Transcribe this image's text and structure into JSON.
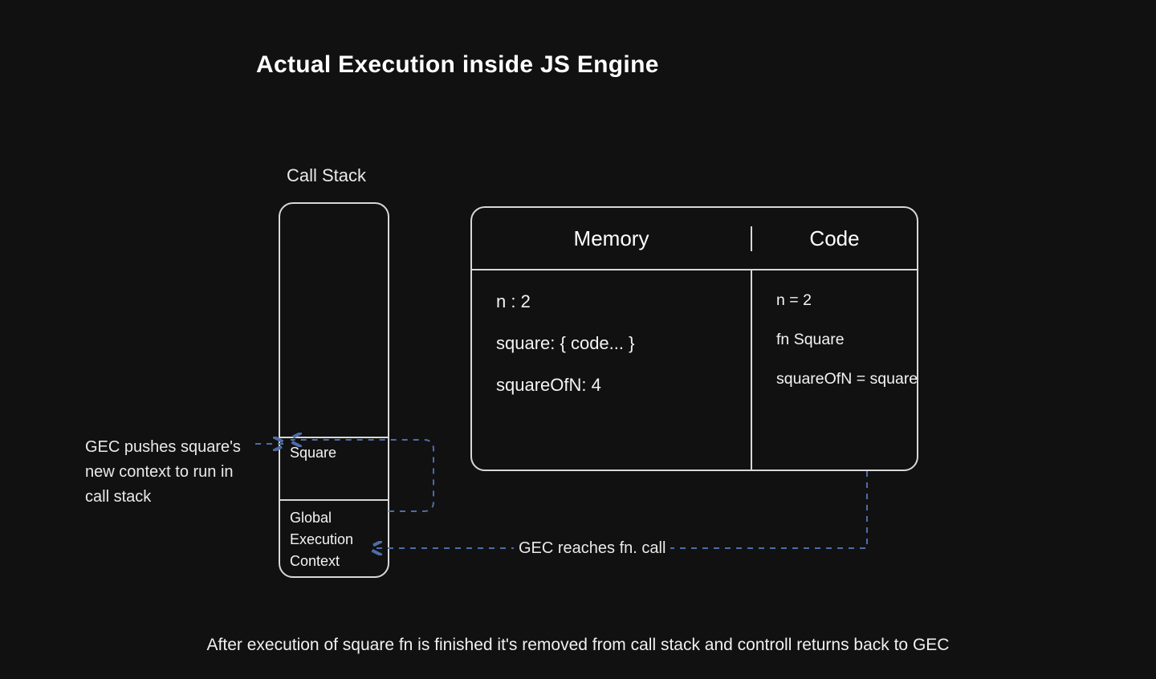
{
  "title": "Actual Execution inside JS Engine",
  "callstack": {
    "label": "Call Stack",
    "frames": {
      "square": "Square",
      "gec": "Global Execution Context"
    }
  },
  "leftNote": "GEC pushes square's new context to run in call stack",
  "ecTable": {
    "headers": {
      "memory": "Memory",
      "code": "Code"
    },
    "memory": {
      "n": "n : 2",
      "square": "square: { code... }",
      "squareOfN": "squareOfN: 4"
    },
    "code": {
      "n": "n = 2",
      "fn": "fn Square",
      "call": "squareOfN = square(n)"
    }
  },
  "arrowLabel": "GEC reaches fn. call",
  "caption": "After execution of square fn is finished it's removed from call stack and controll returns back to GEC"
}
